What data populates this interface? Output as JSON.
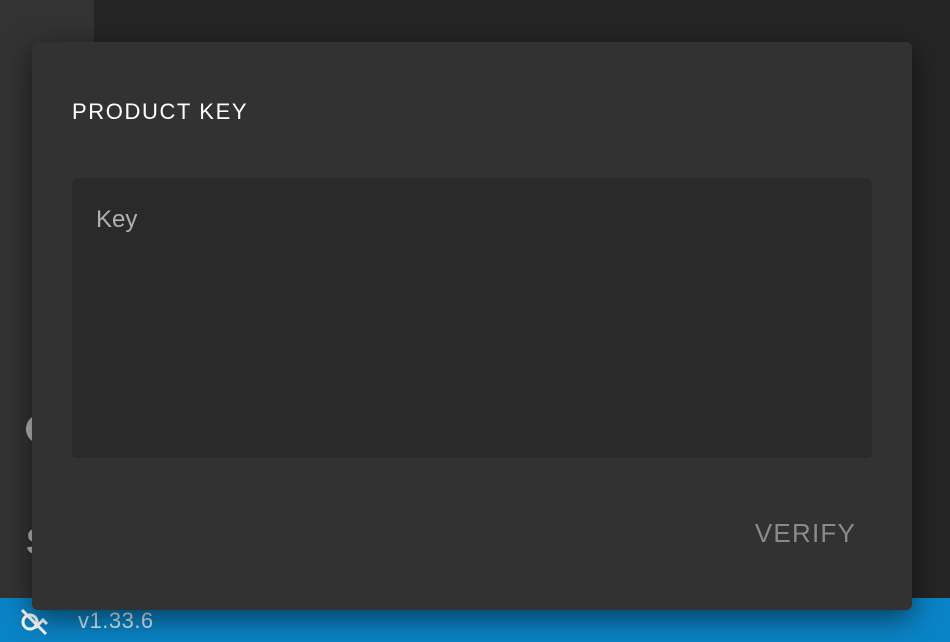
{
  "dialog": {
    "title": "PRODUCT KEY",
    "key_placeholder": "Key",
    "key_value": "",
    "verify_label": "VERIFY"
  },
  "status_bar": {
    "icon": "connection-off-icon",
    "version": "v1.33.6"
  },
  "colors": {
    "status_bar": "#0a84c6",
    "dialog_bg": "#323232",
    "field_bg": "#2a2a2a"
  }
}
